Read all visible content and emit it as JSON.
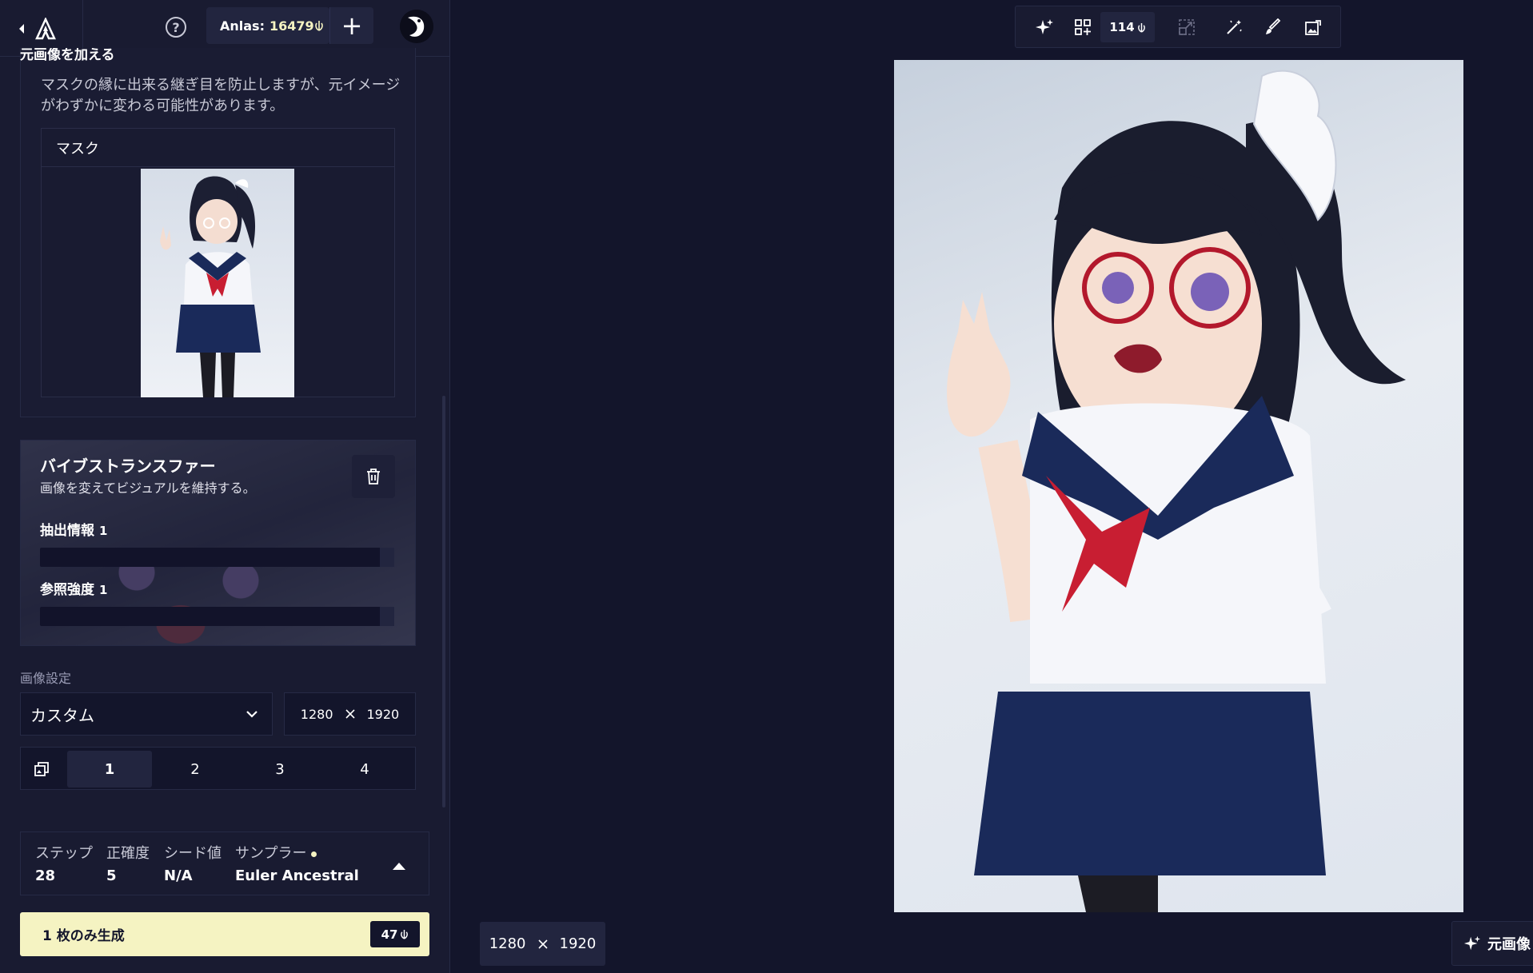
{
  "topbar": {
    "anlas_label": "Anlas:",
    "anlas_value": "16479"
  },
  "mask_section": {
    "title": "元画像を加える",
    "description": "マスクの縁に出来る継ぎ目を防止しますが、元イメージがわずかに変わる可能性があります。",
    "mask_label": "マスク"
  },
  "vibe_transfer": {
    "title": "バイブストランスファー",
    "description": "画像を変えてビジュアルを維持する。",
    "info_label": "抽出情報",
    "info_value": "1",
    "strength_label": "参照強度",
    "strength_value": "1"
  },
  "image_settings": {
    "section_label": "画像設定",
    "preset": "カスタム",
    "width": "1280",
    "height": "1920",
    "count_options": [
      "1",
      "2",
      "3",
      "4"
    ],
    "selected_count": "1"
  },
  "params": {
    "steps_label": "ステップ",
    "steps_value": "28",
    "guidance_label": "正確度",
    "guidance_value": "5",
    "seed_label": "シード値",
    "seed_value": "N/A",
    "sampler_label": "サンプラー",
    "sampler_value": "Euler Ancestral"
  },
  "generate": {
    "label": "1 枚のみ生成",
    "cost": "47"
  },
  "toolbar": {
    "cost": "114"
  },
  "canvas": {
    "width": "1280",
    "height": "1920",
    "orig_button_label": "元画像"
  },
  "colors": {
    "background": "#13152b",
    "panel": "#191b31",
    "accent": "#f5f3c2",
    "border": "#262a45"
  }
}
